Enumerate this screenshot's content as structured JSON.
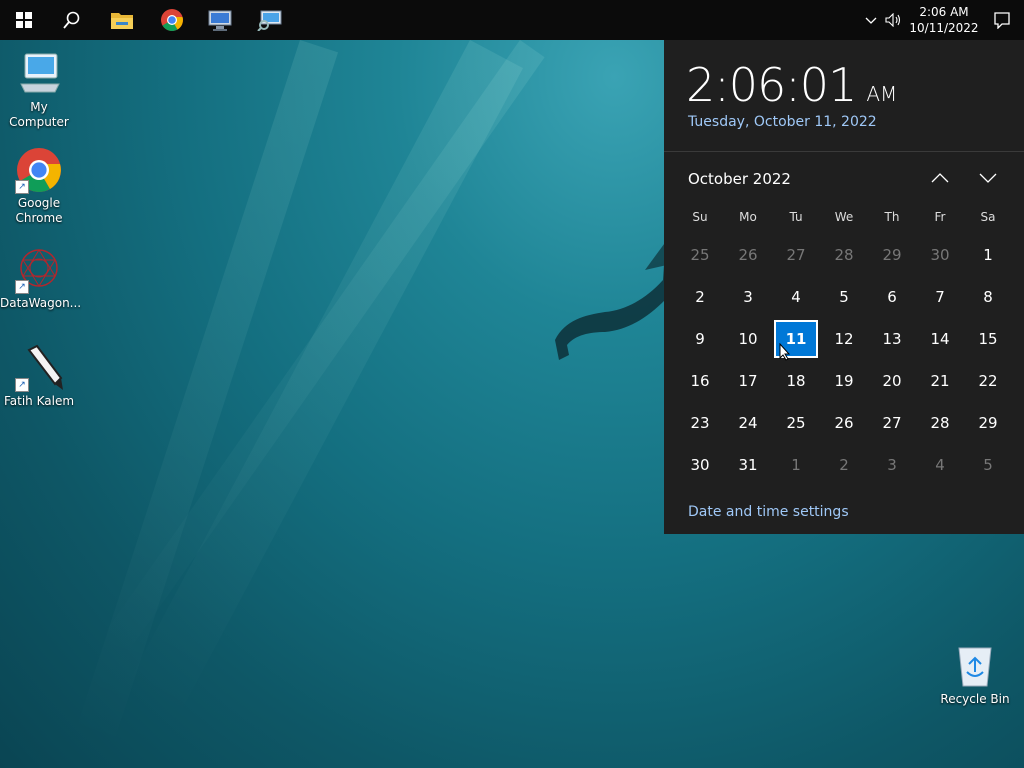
{
  "taskbar": {
    "clock_time": "2:06 AM",
    "clock_date": "10/11/2022",
    "icons": [
      "windows-start-icon",
      "search-icon",
      "file-explorer-icon",
      "chrome-icon",
      "network-computer-icon",
      "remote-desktop-icon"
    ]
  },
  "desktop": {
    "icons": [
      {
        "label": "My Computer",
        "name": "my-computer"
      },
      {
        "label": "Google Chrome",
        "name": "google-chrome"
      },
      {
        "label": "DataWagon...",
        "name": "datawagon"
      },
      {
        "label": "Fatih Kalem",
        "name": "fatih-kalem"
      },
      {
        "label": "Recycle Bin",
        "name": "recycle-bin"
      }
    ]
  },
  "flyout": {
    "time": "2:06:01",
    "ampm": "AM",
    "long_date": "Tuesday, October 11, 2022",
    "month_label": "October 2022",
    "weekdays": [
      "Su",
      "Mo",
      "Tu",
      "We",
      "Th",
      "Fr",
      "Sa"
    ],
    "weeks": [
      [
        "25",
        "26",
        "27",
        "28",
        "29",
        "30",
        "1"
      ],
      [
        "2",
        "3",
        "4",
        "5",
        "6",
        "7",
        "8"
      ],
      [
        "9",
        "10",
        "11",
        "12",
        "13",
        "14",
        "15"
      ],
      [
        "16",
        "17",
        "18",
        "19",
        "20",
        "21",
        "22"
      ],
      [
        "23",
        "24",
        "25",
        "26",
        "27",
        "28",
        "29"
      ],
      [
        "30",
        "31",
        "1",
        "2",
        "3",
        "4",
        "5"
      ]
    ],
    "other_month": [
      [
        0,
        0
      ],
      [
        0,
        1
      ],
      [
        0,
        2
      ],
      [
        0,
        3
      ],
      [
        0,
        4
      ],
      [
        0,
        5
      ],
      [
        5,
        2
      ],
      [
        5,
        3
      ],
      [
        5,
        4
      ],
      [
        5,
        5
      ],
      [
        5,
        6
      ]
    ],
    "today": [
      2,
      2
    ],
    "settings_link": "Date and time settings"
  },
  "colors": {
    "accent": "#0078d7",
    "link": "#9fc8f7",
    "flyout_bg": "#1f1f1f",
    "taskbar_bg": "#0b0b0b"
  }
}
